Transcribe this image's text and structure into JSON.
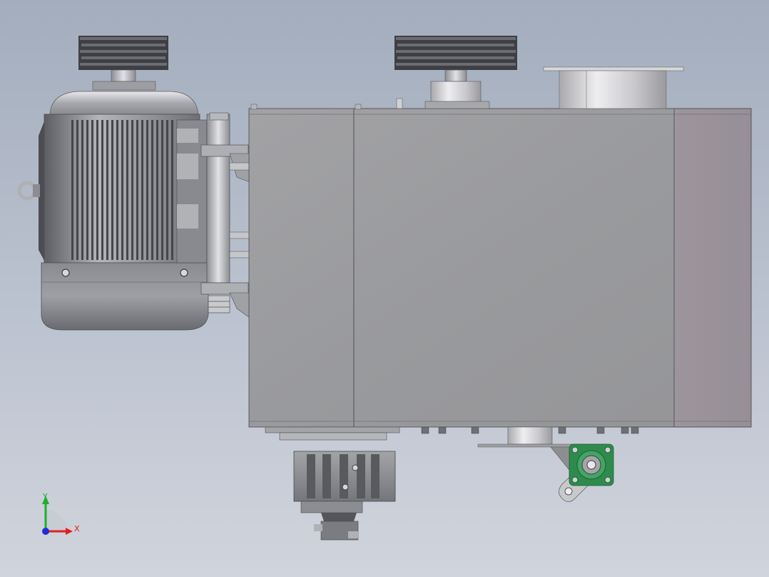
{
  "viewport": {
    "background_top": "#a3adbd",
    "background_bottom": "#d0d4dc"
  },
  "triad": {
    "x_label": "X",
    "y_label": "Y",
    "x_color": "#e0201c",
    "y_color": "#1fae2e",
    "z_color": "#1d2fd6"
  },
  "colors": {
    "motor_body": "#8e8f95",
    "motor_dark": "#4a4b50",
    "housing": "#9b9b9e",
    "housing_end": "#9b949b",
    "bearing_green": "#2f8a4e",
    "steel_light": "#d6d6da"
  }
}
